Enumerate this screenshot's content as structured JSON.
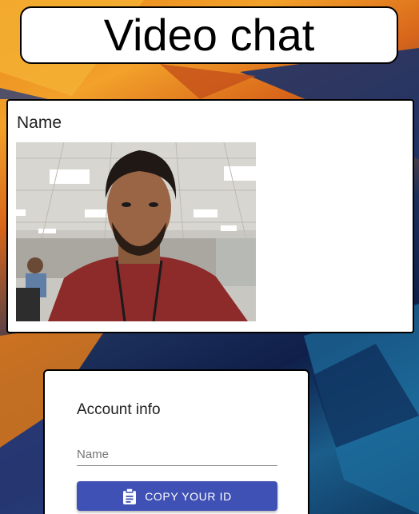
{
  "header": {
    "title": "Video chat"
  },
  "video": {
    "name_label": "Name"
  },
  "account": {
    "title": "Account info",
    "name_placeholder": "Name",
    "name_value": "",
    "copy_button_label": "COPY YOUR ID",
    "copy_button_icon": "clipboard-icon"
  },
  "colors": {
    "primary": "#3f51b5",
    "card_background": "#ffffff",
    "border": "#000000"
  }
}
